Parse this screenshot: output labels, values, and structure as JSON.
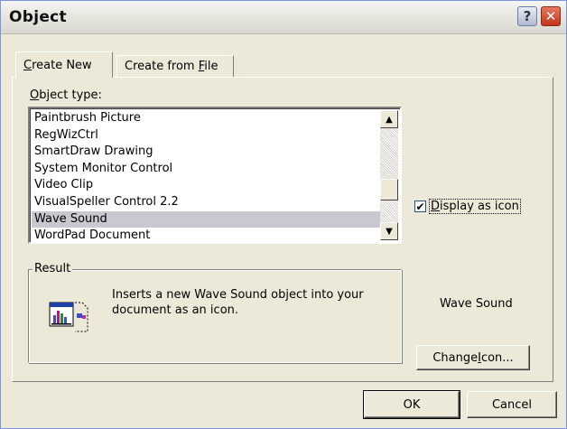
{
  "window": {
    "title": "Object"
  },
  "titlebar": {
    "help_glyph": "?",
    "close_glyph": "✕"
  },
  "tabs": [
    {
      "label_pre": "",
      "label_key": "C",
      "label_post": "reate New",
      "active": true
    },
    {
      "label_pre": "Create from ",
      "label_key": "F",
      "label_post": "ile",
      "active": false
    }
  ],
  "object_type": {
    "label_key": "O",
    "label_rest": "bject type:",
    "items": [
      "Paintbrush Picture",
      "RegWizCtrl",
      "SmartDraw Drawing",
      "System Monitor Control",
      "Video Clip",
      "VisualSpeller Control 2.2",
      "Wave Sound",
      "WordPad Document"
    ],
    "selected_index": 6
  },
  "display_as_icon": {
    "label_key": "D",
    "label_rest": "isplay as icon",
    "checked": true,
    "check_glyph": "✔"
  },
  "result": {
    "legend": "Result",
    "text": "Inserts a new Wave Sound object into your document as an icon.",
    "icon": "wave-sound-object-icon"
  },
  "icon_caption": "Wave Sound",
  "buttons": {
    "change_icon_pre": "Change ",
    "change_icon_key": "I",
    "change_icon_post": "con...",
    "ok": "OK",
    "cancel": "Cancel"
  },
  "scrollbar": {
    "up_glyph": "▲",
    "down_glyph": "▼"
  },
  "colors": {
    "dialog_bg": "#ece9d8",
    "selection": "#c8c8d0",
    "close_button": "#c2351a"
  }
}
